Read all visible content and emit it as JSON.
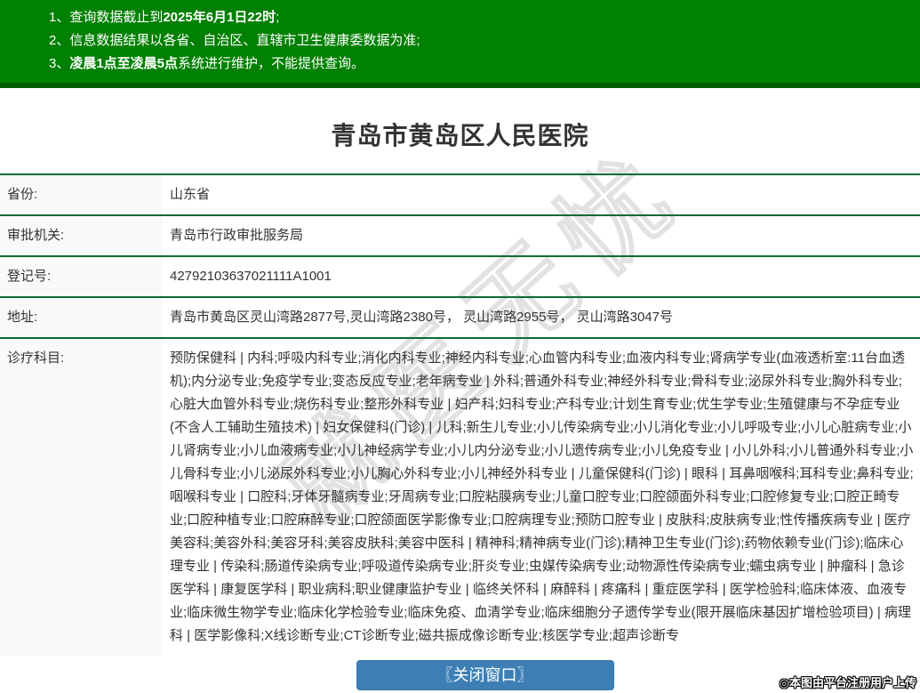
{
  "notice_bar": {
    "item1": {
      "pre": "1、查询数据截止到",
      "bold": "2025年6月1日22时",
      "post": ";"
    },
    "item2": {
      "text": "2、信息数据结果以各省、自治区、直辖市卫生健康委数据为准;"
    },
    "item3": {
      "pre": "3、",
      "bold": "凌晨1点至凌晨5点",
      "post": "系统进行维护，不能提供查询。"
    }
  },
  "page_title": "青岛市黄岛区人民医院",
  "info": {
    "rows": [
      {
        "label": "省份:",
        "value": "山东省"
      },
      {
        "label": "审批机关:",
        "value": "青岛市行政审批服务局"
      },
      {
        "label": "登记号:",
        "value": "42792103637021111A1001"
      },
      {
        "label": "地址:",
        "value": "青岛市黄岛区灵山湾路2877号,灵山湾路2380号， 灵山湾路2955号， 灵山湾路3047号"
      },
      {
        "label": "诊疗科目:",
        "value": "预防保健科 | 内科;呼吸内科专业;消化内科专业;神经内科专业;心血管内科专业;血液内科专业;肾病学专业(血液透析室:11台血透机);内分泌专业;免疫学专业;变态反应专业;老年病专业 | 外科;普通外科专业;神经外科专业;骨科专业;泌尿外科专业;胸外科专业;心脏大血管外科专业;烧伤科专业;整形外科专业 | 妇产科;妇科专业;产科专业;计划生育专业;优生学专业;生殖健康与不孕症专业(不含人工辅助生殖技术) | 妇女保健科(门诊) | 儿科;新生儿专业;小儿传染病专业;小儿消化专业;小儿呼吸专业;小儿心脏病专业;小儿肾病专业;小儿血液病专业;小儿神经病学专业;小儿内分泌专业;小儿遗传病专业;小儿免疫专业 | 小儿外科;小儿普通外科专业;小儿骨科专业;小儿泌尿外科专业;小儿胸心外科专业;小儿神经外科专业 | 儿童保健科(门诊) | 眼科 | 耳鼻咽喉科;耳科专业;鼻科专业;咽喉科专业 | 口腔科;牙体牙髓病专业;牙周病专业;口腔粘膜病专业;儿童口腔专业;口腔颌面外科专业;口腔修复专业;口腔正畸专业;口腔种植专业;口腔麻醉专业;口腔颌面医学影像专业;口腔病理专业;预防口腔专业 | 皮肤科;皮肤病专业;性传播疾病专业 | 医疗美容科;美容外科;美容牙科;美容皮肤科;美容中医科 | 精神科;精神病专业(门诊);精神卫生专业(门诊);药物依赖专业(门诊);临床心理专业 | 传染科;肠道传染病专业;呼吸道传染病专业;肝炎专业;虫媒传染病专业;动物源性传染病专业;蠕虫病专业 | 肿瘤科 | 急诊医学科 | 康复医学科 | 职业病科;职业健康监护专业 | 临终关怀科 | 麻醉科 | 疼痛科 | 重症医学科 | 医学检验科;临床体液、血液专业;临床微生物学专业;临床化学检验专业;临床免疫、血清学专业;临床细胞分子遗传学专业(限开展临床基因扩增检验项目) | 病理科 | 医学影像科;X线诊断专业;CT诊断专业;磁共振成像诊断专业;核医学专业;超声诊断专"
      }
    ]
  },
  "watermark_text": "就医无忧",
  "footer": {
    "close_button_label": "〖关闭窗口〗",
    "attribution": "◎本图由平台注册用户上传"
  },
  "colors": {
    "banner_green": "#008000",
    "banner_border_green": "#005c00",
    "row_divider_green": "#0e6b35",
    "label_bg": "#f9f9f9",
    "button_blue": "#3d7fb5",
    "text": "#333333"
  }
}
